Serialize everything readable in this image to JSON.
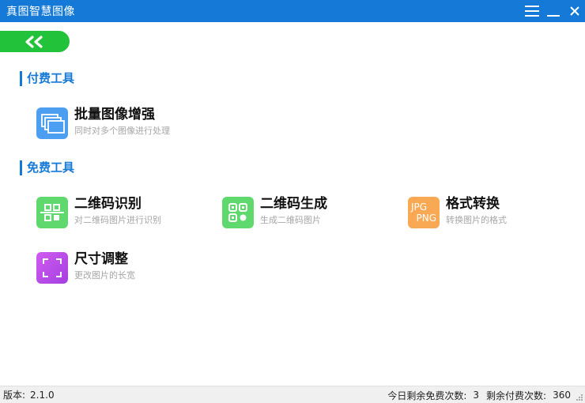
{
  "app": {
    "title": "真图智慧图像"
  },
  "titlebar": {
    "menu_icon": "menu-icon",
    "minimize_icon": "minimize-icon",
    "close_icon": "close-icon"
  },
  "back_button": {
    "icon": "double-chevron-left-icon",
    "color": "#22c33a"
  },
  "colors": {
    "accent": "#1479d7",
    "green": "#22c33a"
  },
  "paid_section": {
    "title": "付费工具",
    "tools": [
      {
        "name": "批量图像增强",
        "desc": "同时对多个图像进行处理",
        "icon": "stacked-images-icon"
      }
    ]
  },
  "free_section": {
    "title": "免费工具",
    "tools": [
      {
        "name": "二维码识别",
        "desc": "对二维码图片进行识别",
        "icon": "qr-scan-icon"
      },
      {
        "name": "二维码生成",
        "desc": "生成二维码图片",
        "icon": "qr-code-icon"
      },
      {
        "name": "格式转换",
        "desc": "转换图片的格式",
        "icon": "format-convert-icon",
        "icon_text_1": "JPG",
        "icon_text_2": "PNG"
      },
      {
        "name": "尺寸调整",
        "desc": "更改图片的长宽",
        "icon": "resize-frame-icon"
      }
    ]
  },
  "statusbar": {
    "version_label": "版本:",
    "version": "2.1.0",
    "free_label": "今日剩余免费次数:",
    "free_count": "3",
    "paid_label": "剩余付费次数:",
    "paid_count": "360"
  }
}
